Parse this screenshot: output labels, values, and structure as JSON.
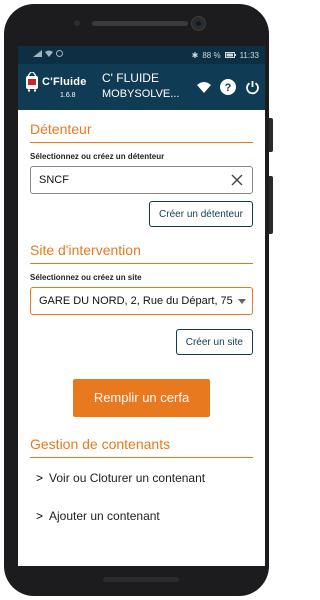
{
  "statusbar": {
    "battery": "88 %",
    "time": "11:33"
  },
  "appbar": {
    "logo_text": "C'Fluide",
    "version": "1.6.8",
    "title": "C' FLUIDE",
    "subtitle": "MOBYSOLVE...",
    "icons": [
      "wifi-icon",
      "help-icon",
      "power-icon"
    ]
  },
  "detenteur": {
    "section_title": "Détenteur",
    "label": "Sélectionnez ou créez un détenteur",
    "value": "SNCF",
    "create_button": "Créer un détenteur"
  },
  "site": {
    "section_title": "Site d'intervention",
    "label": "Sélectionnez ou créez un site",
    "value": "GARE DU NORD, 2, Rue du Départ, 75",
    "create_button": "Créer un site"
  },
  "cerfa_button": "Remplir un cerfa",
  "contenants": {
    "section_title": "Gestion de contenants",
    "links": [
      {
        "label": "Voir ou Cloturer un contenant"
      },
      {
        "label": "Ajouter un contenant"
      }
    ]
  },
  "colors": {
    "primary": "#0f3b54",
    "accent": "#e8791e",
    "statusbar": "#0c2f43"
  }
}
